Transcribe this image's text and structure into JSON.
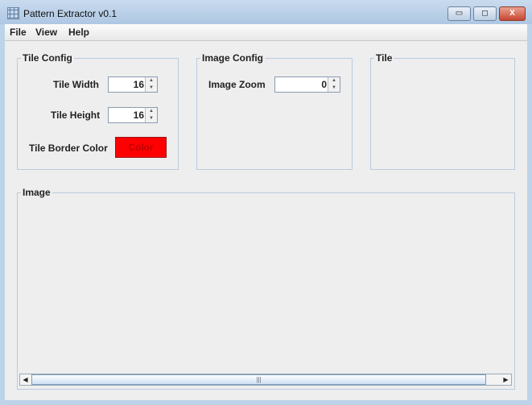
{
  "window": {
    "title": "Pattern Extractor v0.1",
    "minimize": "▭",
    "maximize": "◻",
    "close": "X"
  },
  "menu": [
    "File",
    "View",
    "Help"
  ],
  "tile_config": {
    "title": "Tile Config",
    "width_label": "Tile Width",
    "width_value": "16",
    "height_label": "Tile Height",
    "height_value": "16",
    "border_color_label": "Tile Border Color",
    "color_button": "Color",
    "border_color": "#ff0000"
  },
  "image_config": {
    "title": "Image Config",
    "zoom_label": "Image Zoom",
    "zoom_value": "0"
  },
  "tile_panel": {
    "title": "Tile"
  },
  "image_panel": {
    "title": "Image"
  },
  "icons": {
    "scroll_left": "◀",
    "scroll_right": "▶",
    "thumb_grip": "|||",
    "spin_up": "▲",
    "spin_down": "▼"
  }
}
